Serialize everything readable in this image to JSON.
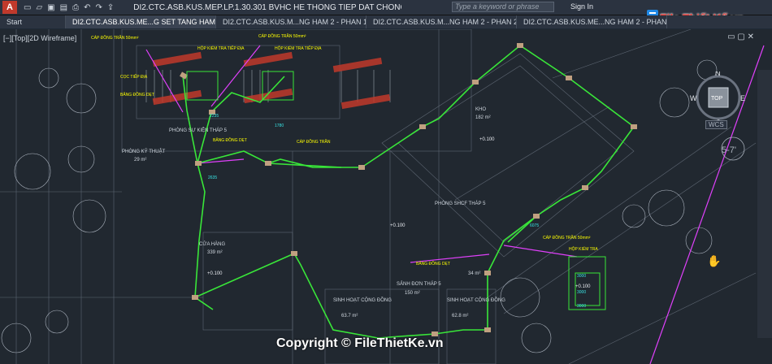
{
  "window": {
    "app_letter": "A",
    "title": "DI2.CTC.ASB.KUS.MEP.LP.1.30.301 BVHC HE THONG TIEP DAT CHONG SET TANG HA...",
    "search_placeholder": "Type a keyword or phrase",
    "sign_in": "Sign In"
  },
  "tabs": [
    {
      "label": "Start"
    },
    {
      "label": "DI2.CTC.ASB.KUS.ME...G SET TANG HAM 2*"
    },
    {
      "label": "DI2.CTC.ASB.KUS.M...NG HAM 2 - PHAN 1*"
    },
    {
      "label": "DI2.CTC.ASB.KUS.M...NG HAM 2 - PHAN 2*"
    },
    {
      "label": "DI2.CTC.ASB.KUS.ME...NG HAM 2 - PHAN"
    }
  ],
  "viewport": {
    "label": "[−][Top][2D Wireframe]",
    "top_button": "TOP",
    "wcs": "WCS",
    "compass": {
      "n": "N",
      "s": "S",
      "e": "E",
      "w": "W"
    }
  },
  "drawing": {
    "rooms": [
      {
        "name": "KHO",
        "area": "182 m²"
      },
      {
        "name": "CỬA HÀNG",
        "area": "339 m²"
      },
      {
        "name": "SẢNH ĐƠN THÁP 5",
        "area": "150 m²"
      },
      {
        "name": "SINH HOẠT CỘNG ĐỒNG",
        "area": "63.7 m²"
      },
      {
        "name": "SINH HOẠT CỘNG ĐỒNG",
        "area": "62.8 m²"
      },
      {
        "name": "PHÒNG SHCF THÁP 5",
        "area": ""
      },
      {
        "name": "PHÒNG KỸ THUẬT",
        "area": "29 m²"
      },
      {
        "name": "PHÒNG SỰ KIỆN THÁP 5",
        "area": "34 m²"
      }
    ],
    "levels": [
      "+0.100",
      "+0.100",
      "+0.100",
      "+0.100"
    ],
    "dims": [
      "2235",
      "2635",
      "3000",
      "3000",
      "3000",
      "6075",
      "1780"
    ],
    "grid_bubble": "5-7'"
  },
  "branding": {
    "logo": "File Thiết Kế",
    "logo_suffix": ".vn",
    "watermark": "Copyright © FileThietKe.vn"
  },
  "colors": {
    "background": "#212830",
    "conductor": "#39e639",
    "highlight": "#e040fb",
    "label": "#ffff00",
    "walls": "#cfd6de"
  }
}
